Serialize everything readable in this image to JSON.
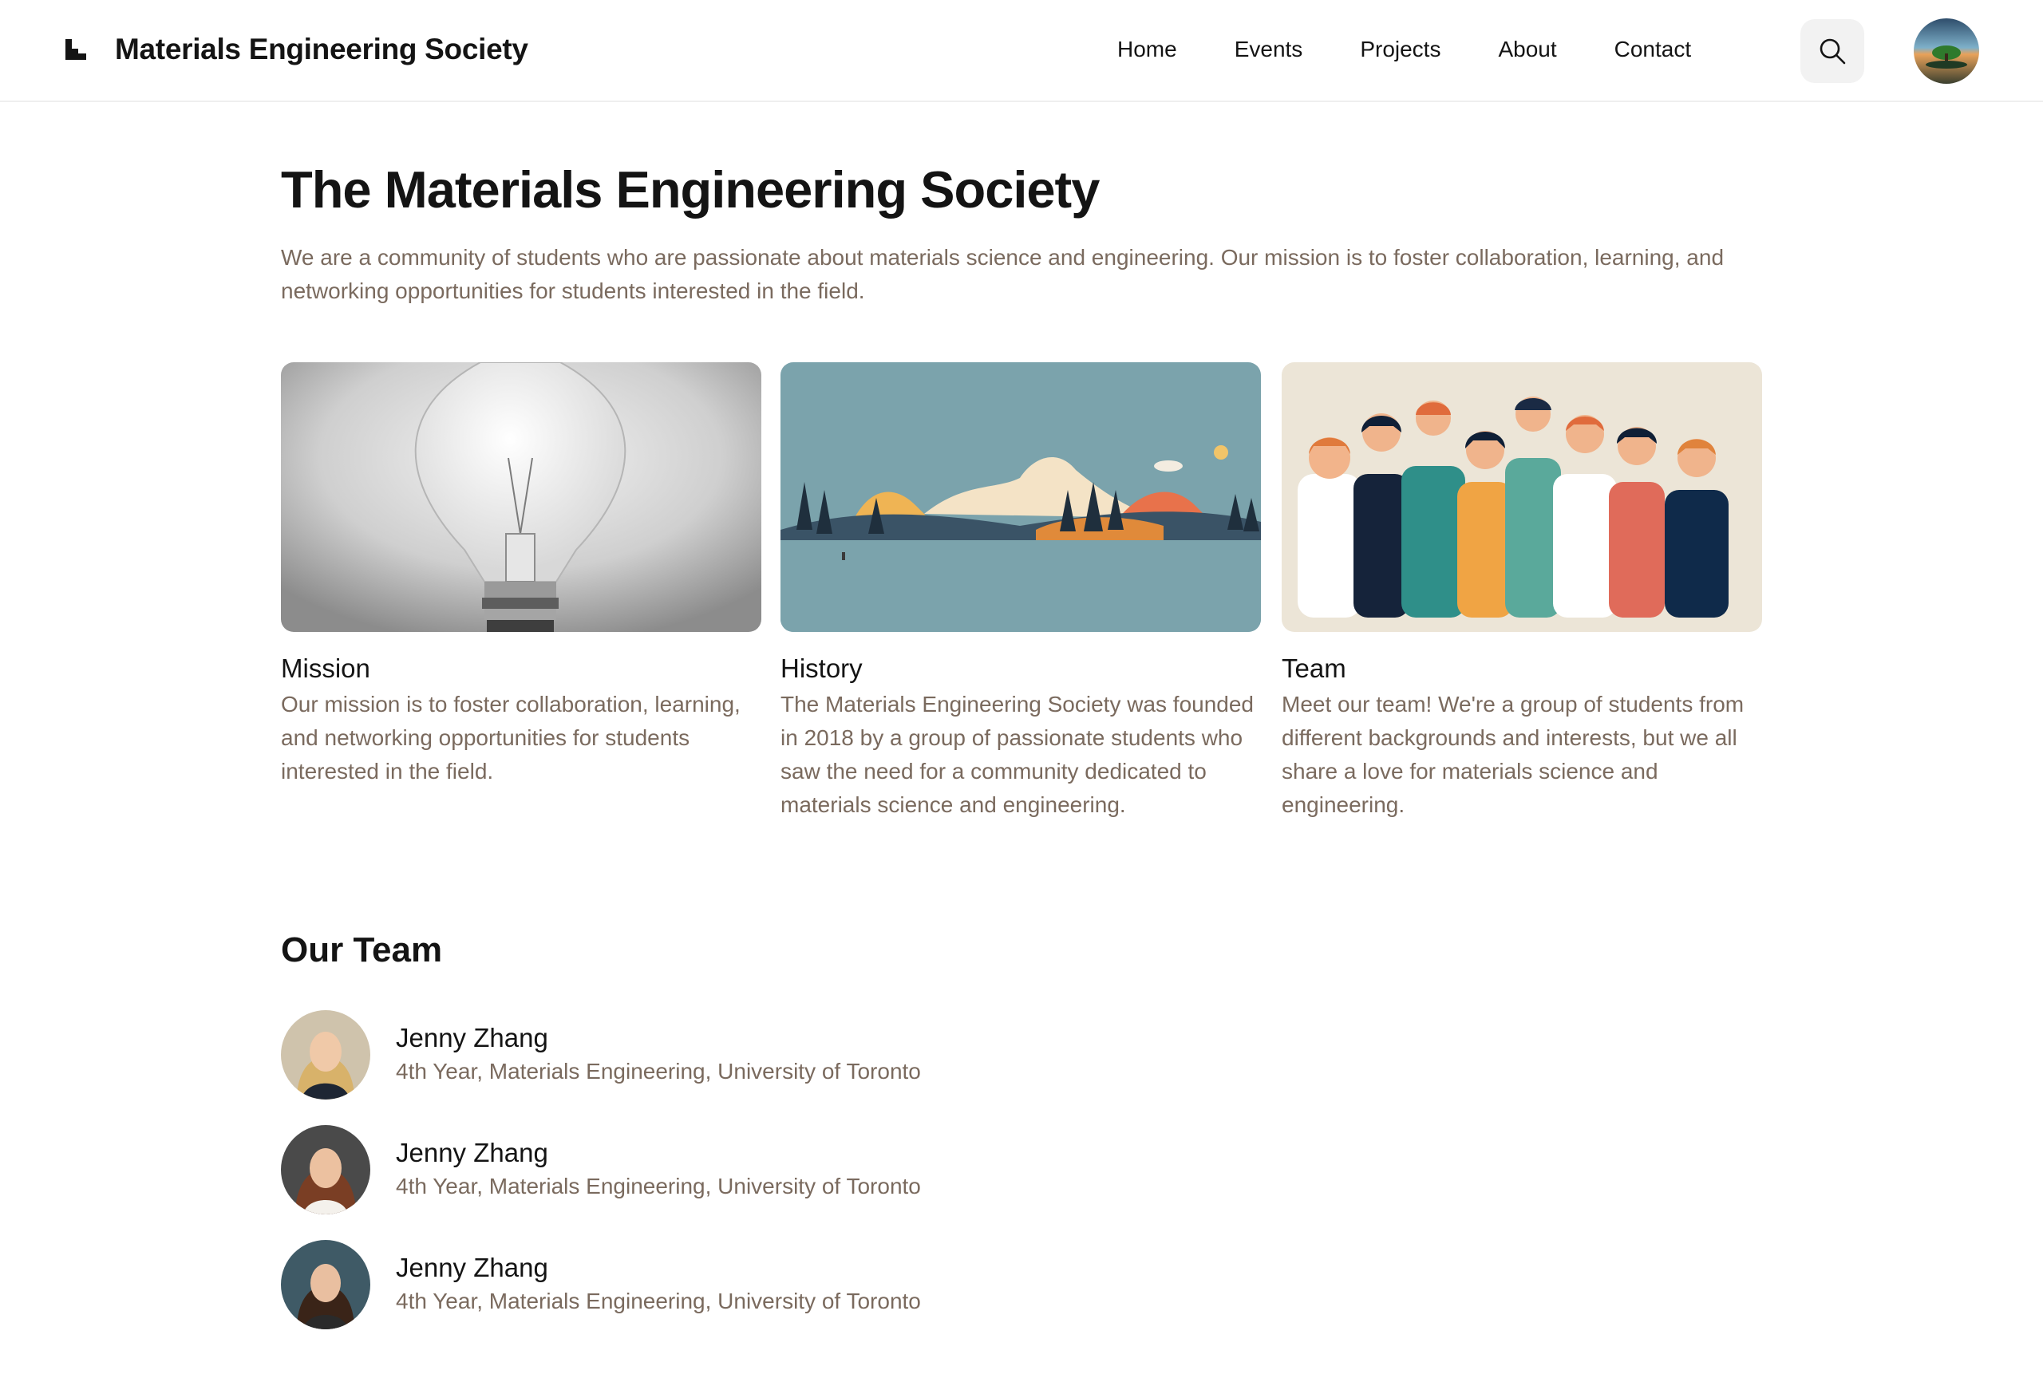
{
  "header": {
    "brand_name": "Materials Engineering Society",
    "nav": [
      {
        "label": "Home"
      },
      {
        "label": "Events"
      },
      {
        "label": "Projects"
      },
      {
        "label": "About"
      },
      {
        "label": "Contact"
      }
    ],
    "search_icon": "search-icon",
    "profile_avatar": "user-avatar"
  },
  "hero": {
    "title": "The Materials Engineering Society",
    "description": "We are a community of students who are passionate about materials science and engineering. Our mission is to foster collaboration, learning, and networking opportunities for students interested in the field."
  },
  "cards": [
    {
      "title": "Mission",
      "text": "Our mission is to foster collaboration, learning, and networking opportunities for students interested in the field."
    },
    {
      "title": "History",
      "text": "The Materials Engineering Society was founded in 2018 by a group of passionate students who saw the need for a community dedicated to materials science and engineering."
    },
    {
      "title": "Team",
      "text": "Meet our team! We're a group of students from different backgrounds and interests, but we all share a love for materials science and engineering."
    }
  ],
  "team": {
    "title": "Our Team",
    "members": [
      {
        "name": "Jenny Zhang",
        "role": "4th Year, Materials Engineering, University of Toronto"
      },
      {
        "name": "Jenny Zhang",
        "role": "4th Year, Materials Engineering, University of Toronto"
      },
      {
        "name": "Jenny Zhang",
        "role": "4th Year, Materials Engineering, University of Toronto"
      }
    ]
  },
  "colors": {
    "text_primary": "#141414",
    "text_secondary": "#7a6a5e",
    "search_bg": "#f2f2f2"
  }
}
